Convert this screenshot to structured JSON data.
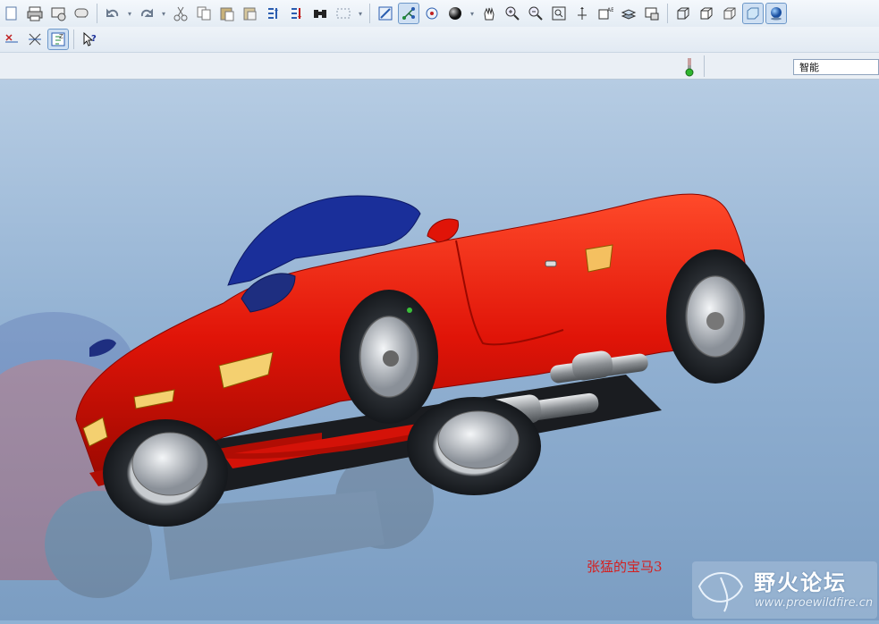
{
  "statusbar": {
    "filter_value": "智能"
  },
  "viewport": {
    "caption": "张猛的宝马3",
    "watermark_title": "野火论坛",
    "watermark_url": "www.proewildfire.cn"
  },
  "toolbar_icons": [
    "new-file-icon",
    "print-icon",
    "email-icon",
    "email-link-icon",
    "undo-icon",
    "redo-icon",
    "cut-icon",
    "copy-icon",
    "paste-icon",
    "paste-special-icon",
    "regenerate-icon",
    "regen-manager-icon",
    "find-icon",
    "select-box-icon",
    "repaint-icon",
    "spin-center-icon",
    "orient-mode-icon",
    "display-style-icon",
    "pan-icon",
    "zoom-in-icon",
    "zoom-out-icon",
    "refit-icon",
    "reorient-icon",
    "saved-views-icon",
    "layers-icon",
    "view-manager-icon",
    "wireframe-icon",
    "hidden-line-icon",
    "no-hidden-icon",
    "shading-icon",
    "enhanced-realism-icon"
  ],
  "colors": {
    "car_body": "#e01408",
    "windshield": "#1a2f9a",
    "caption": "#d42020"
  }
}
